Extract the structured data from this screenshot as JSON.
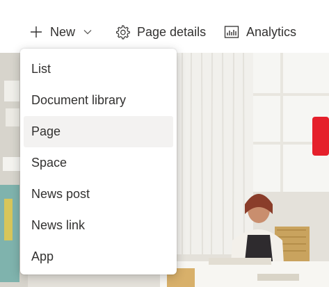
{
  "commandbar": {
    "new_label": "New",
    "page_details_label": "Page details",
    "analytics_label": "Analytics"
  },
  "icons": {
    "new": "plus-icon",
    "new_dropdown": "chevron-down-icon",
    "page_details": "gear-icon",
    "analytics": "bar-chart-icon"
  },
  "new_menu": {
    "items": [
      {
        "label": "List"
      },
      {
        "label": "Document library"
      },
      {
        "label": "Page",
        "highlighted": true
      },
      {
        "label": "Space"
      },
      {
        "label": "News post"
      },
      {
        "label": "News link"
      },
      {
        "label": "App"
      }
    ]
  },
  "colors": {
    "text": "#323130",
    "menu_hover": "#f3f2f1",
    "menu_bg": "#ffffff",
    "accent_red": "#e5202b"
  }
}
